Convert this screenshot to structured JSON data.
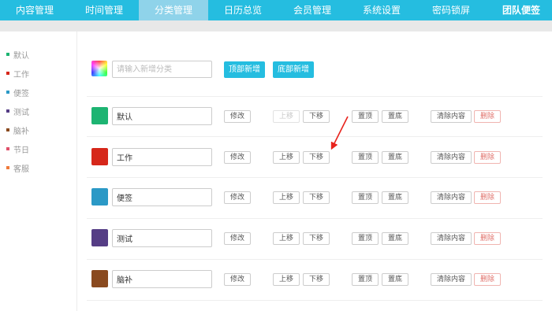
{
  "nav": {
    "items": [
      {
        "label": "内容管理",
        "active": false
      },
      {
        "label": "时间管理",
        "active": false
      },
      {
        "label": "分类管理",
        "active": true
      },
      {
        "label": "日历总览",
        "active": false
      },
      {
        "label": "会员管理",
        "active": false
      },
      {
        "label": "系统设置",
        "active": false
      },
      {
        "label": "密码锁屏",
        "active": false
      }
    ],
    "brand": "团队便签"
  },
  "sidebar": {
    "items": [
      {
        "label": "默认",
        "color": "#1db472"
      },
      {
        "label": "工作",
        "color": "#d6271a"
      },
      {
        "label": "便签",
        "color": "#2b99c6"
      },
      {
        "label": "测试",
        "color": "#553d85"
      },
      {
        "label": "脑补",
        "color": "#8a4a1f"
      },
      {
        "label": "节日",
        "color": "#e0506a"
      },
      {
        "label": "客服",
        "color": "#f07a3a"
      }
    ]
  },
  "add": {
    "placeholder": "请输入新增分类",
    "value": "",
    "top_button": "顶部新增",
    "bottom_button": "底部新增"
  },
  "buttons": {
    "edit": "修改",
    "up": "上移",
    "down": "下移",
    "top": "置顶",
    "bottom": "置底",
    "clear": "清除内容",
    "delete": "删除"
  },
  "categories": [
    {
      "name": "默认",
      "color": "#1db472",
      "up_disabled": true
    },
    {
      "name": "工作",
      "color": "#d6271a",
      "up_disabled": false
    },
    {
      "name": "便签",
      "color": "#2b99c6",
      "up_disabled": false
    },
    {
      "name": "测试",
      "color": "#553d85",
      "up_disabled": false
    },
    {
      "name": "脑补",
      "color": "#8a4a1f",
      "up_disabled": false
    }
  ],
  "annotation": {
    "arrow_color": "#e8231d"
  }
}
